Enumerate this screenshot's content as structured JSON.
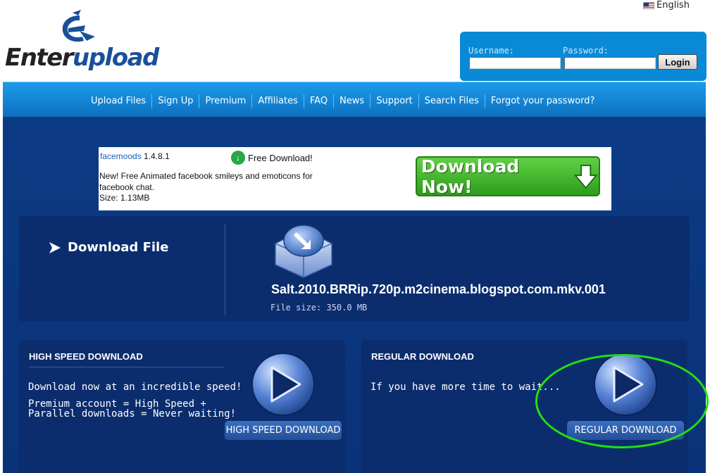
{
  "header": {
    "language": "English",
    "logo_text_a": "Enter",
    "logo_text_b": "upload"
  },
  "login": {
    "username_label": "Username:",
    "password_label": "Password:",
    "login_button": "Login"
  },
  "nav": {
    "items": [
      "Upload Files",
      "Sign Up",
      "Premium",
      "Affiliates",
      "FAQ",
      "News",
      "Support",
      "Search Files",
      "Forgot your password?"
    ]
  },
  "ad": {
    "brand": "facemoods",
    "version": "1.4.8.1",
    "free_download": "Free Download!",
    "description": "New! Free Animated facebook smileys and emoticons for facebook chat.",
    "size": "Size: 1.13MB",
    "button": "Download Now!"
  },
  "file": {
    "section_title": "Download File",
    "name": "Salt.2010.BRRip.720p.m2cinema.blogspot.com.mkv.001",
    "size": "File size: 350.0 MB"
  },
  "high_speed": {
    "title": "HIGH SPEED DOWNLOAD",
    "text1": "Download now at an incredible speed!",
    "text2": "Premium account = High Speed +",
    "text3": "Parallel downloads = Never waiting!",
    "button": "HIGH SPEED DOWNLOAD"
  },
  "regular": {
    "title": "REGULAR DOWNLOAD",
    "text": "If you have more time to wait...",
    "button": "REGULAR DOWNLOAD"
  },
  "colors": {
    "nav_blue": "#1489d8",
    "panel_navy": "#0b2d6e",
    "highlight_green": "#22e010"
  }
}
